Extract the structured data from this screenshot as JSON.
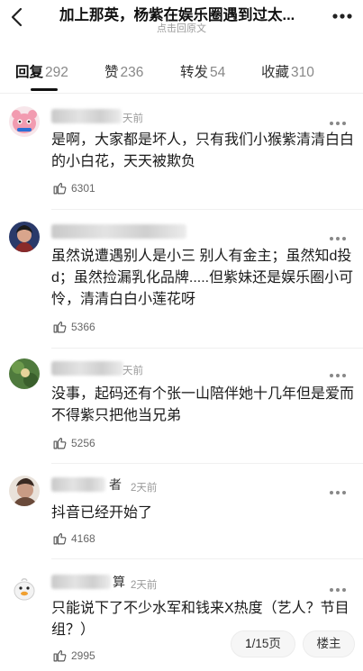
{
  "header": {
    "title": "加上那英，杨紫在娱乐圈遇到过太...",
    "subtitle": "点击回原文"
  },
  "tabs": [
    {
      "label": "回复",
      "count": "292",
      "active": true
    },
    {
      "label": "赞",
      "count": "236",
      "active": false
    },
    {
      "label": "转发",
      "count": "54",
      "active": false
    },
    {
      "label": "收藏",
      "count": "310",
      "active": false
    }
  ],
  "comments": [
    {
      "username_visible": "",
      "username_blurred": true,
      "time": "天前",
      "text": "是啊，大家都是坏人，只有我们小猴紫清清白白的小白花，天天被欺负",
      "likes": "6301",
      "avatar_icon": "pink-cartoon-avatar"
    },
    {
      "username_visible": "",
      "username_blurred": true,
      "time": "",
      "text": "虽然说遭遇别人是小三 别人有金主；虽然知d投d；虽然捡漏乳化品牌.....但紫妹还是娱乐圈小可怜，清清白白小莲花呀",
      "likes": "5366",
      "avatar_icon": "dark-photo-avatar"
    },
    {
      "username_visible": "",
      "username_blurred": true,
      "time": "天前",
      "text": "没事，起码还有个张一山陪伴她十几年但是爱而不得紫只把他当兄弟",
      "likes": "5256",
      "avatar_icon": "green-photo-avatar"
    },
    {
      "username_visible": "者",
      "username_blurred": true,
      "time": "2天前",
      "text": "抖音已经开始了",
      "likes": "4168",
      "avatar_icon": "photo-avatar"
    },
    {
      "username_visible": "算",
      "username_blurred": true,
      "time": "2天前",
      "text": "只能说下了不少水军和钱来X热度（艺人？节目组？）",
      "likes": "2995",
      "avatar_icon": "duck-cartoon-avatar"
    }
  ],
  "pager": {
    "current": "1",
    "total_label": "/15页"
  },
  "floor_button": "楼主",
  "colors": {
    "text": "#1a1a1a",
    "muted": "#999999",
    "active_tab": "#111111"
  }
}
